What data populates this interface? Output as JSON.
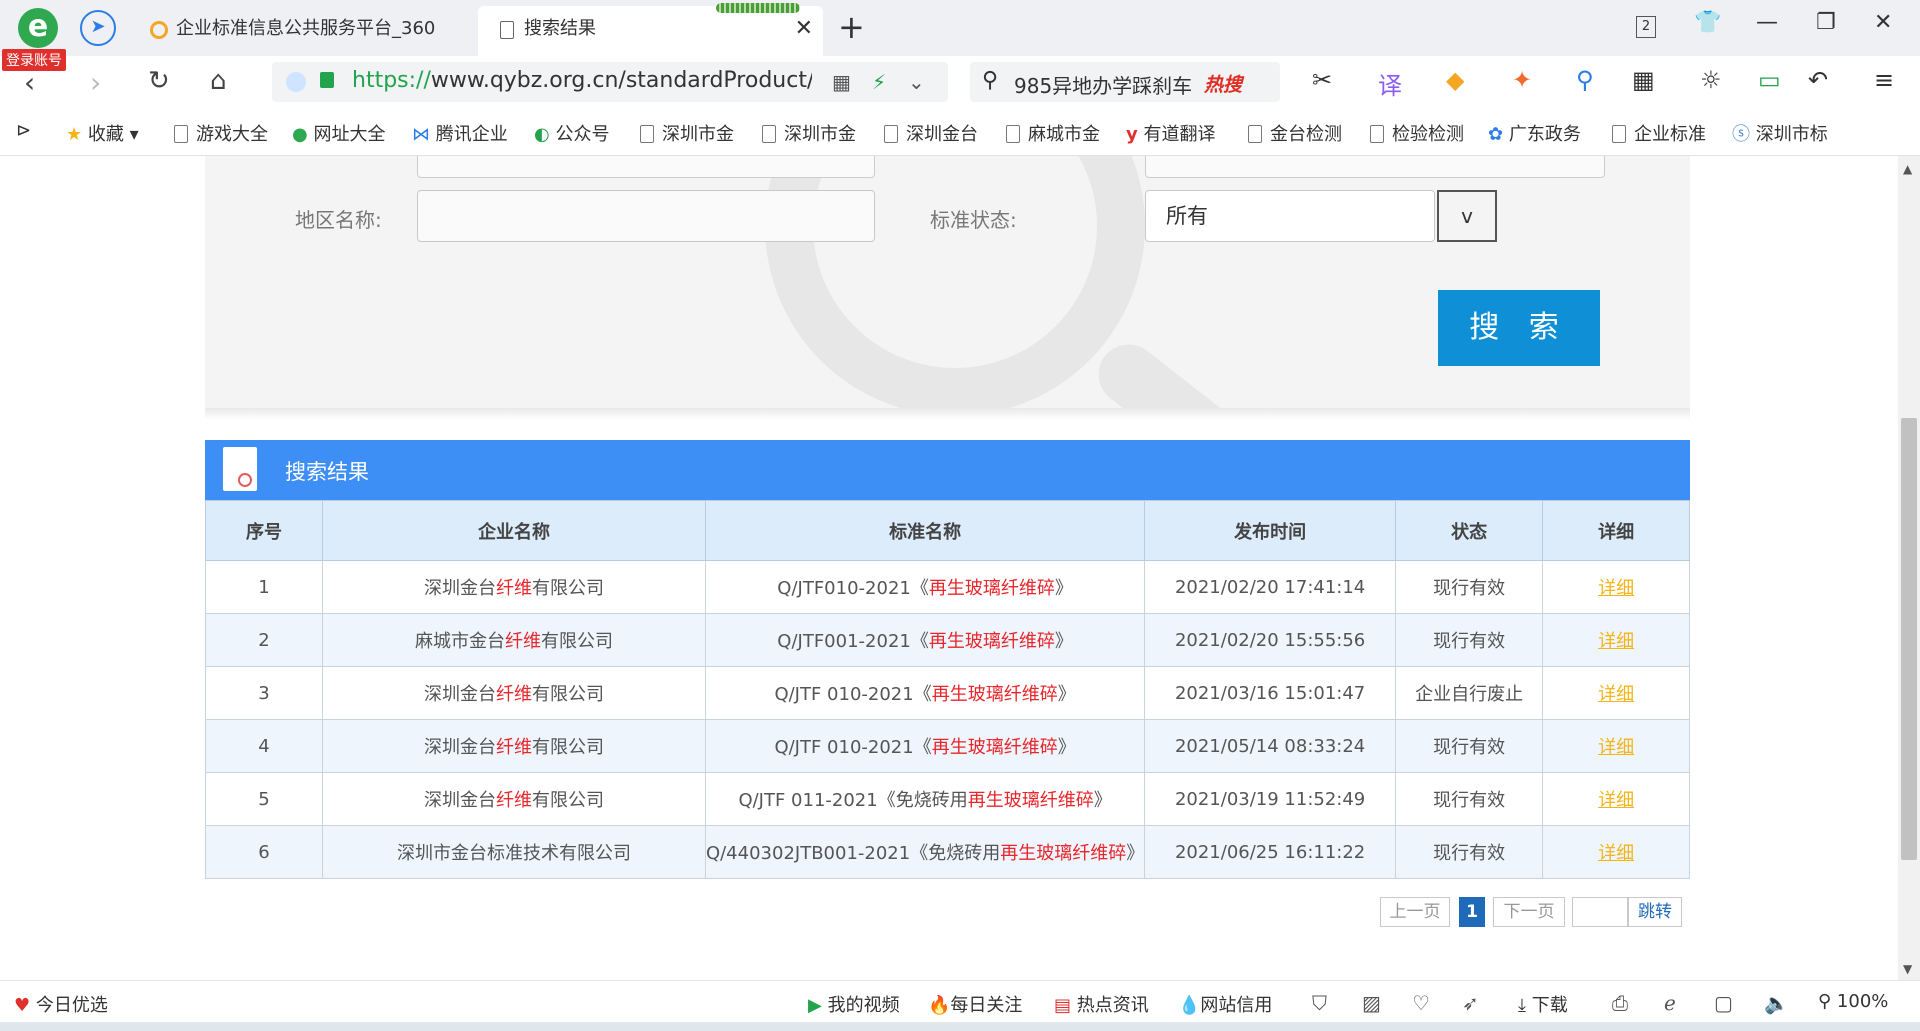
{
  "browser": {
    "login_badge": "登录账号",
    "tabs": [
      {
        "title": "企业标准信息公共服务平台_360",
        "active": false
      },
      {
        "title": "搜索结果",
        "active": true
      }
    ],
    "tab_count": "2",
    "url_scheme": "https://",
    "url_rest": "www.qybz.org.cn/standardProduct/to/",
    "hot_search_text": "985异地办学踩刹车",
    "hot_search_badge": "热搜",
    "bookmarks": [
      "收藏",
      "游戏大全",
      "网址大全",
      "腾讯企业",
      "公众号",
      "深圳市金",
      "深圳市金",
      "深圳金台",
      "麻城市金",
      "有道翻译",
      "金台检测",
      "检验检测",
      "广东政务",
      "企业标准",
      "深圳市标"
    ]
  },
  "search_form": {
    "region_label": "地区名称:",
    "region_value": "",
    "status_label": "标准状态:",
    "status_value": "所有",
    "status_dropdown_btn": "v",
    "search_button": "搜 索"
  },
  "results": {
    "header_title": "搜索结果",
    "columns": [
      "序号",
      "企业名称",
      "标准名称",
      "发布时间",
      "状态",
      "详细"
    ],
    "rows": [
      {
        "no": "1",
        "company_pre": "深圳金台",
        "company_hl": "纤维",
        "company_post": "有限公司",
        "std_pre": "Q/JTF010-2021《",
        "std_hl": "再生玻璃纤维碎",
        "std_post": "》",
        "time": "2021/02/20 17:41:14",
        "status": "现行有效",
        "detail": "详细"
      },
      {
        "no": "2",
        "company_pre": "麻城市金台",
        "company_hl": "纤维",
        "company_post": "有限公司",
        "std_pre": "Q/JTF001-2021《",
        "std_hl": "再生玻璃纤维碎",
        "std_post": "》",
        "time": "2021/02/20 15:55:56",
        "status": "现行有效",
        "detail": "详细"
      },
      {
        "no": "3",
        "company_pre": "深圳金台",
        "company_hl": "纤维",
        "company_post": "有限公司",
        "std_pre": "Q/JTF 010-2021《",
        "std_hl": "再生玻璃纤维碎",
        "std_post": "》",
        "time": "2021/03/16 15:01:47",
        "status": "企业自行废止",
        "detail": "详细"
      },
      {
        "no": "4",
        "company_pre": "深圳金台",
        "company_hl": "纤维",
        "company_post": "有限公司",
        "std_pre": "Q/JTF 010-2021《",
        "std_hl": "再生玻璃纤维碎",
        "std_post": "》",
        "time": "2021/05/14 08:33:24",
        "status": "现行有效",
        "detail": "详细"
      },
      {
        "no": "5",
        "company_pre": "深圳金台",
        "company_hl": "纤维",
        "company_post": "有限公司",
        "std_pre": "Q/JTF 011-2021《免烧砖用",
        "std_hl": "再生玻璃纤维碎",
        "std_post": "》",
        "time": "2021/03/19 11:52:49",
        "status": "现行有效",
        "detail": "详细"
      },
      {
        "no": "6",
        "company_pre": "深圳市金台标准技术有限公司",
        "company_hl": "",
        "company_post": "",
        "std_pre": "Q/440302JTB001-2021《免烧砖用",
        "std_hl": "再生玻璃纤维碎",
        "std_post": "》",
        "time": "2021/06/25 16:11:22",
        "status": "现行有效",
        "detail": "详细"
      }
    ]
  },
  "pager": {
    "prev": "上一页",
    "current": "1",
    "next": "下一页",
    "jump_value": "",
    "jump_button": "跳转"
  },
  "statusbar": {
    "left": "今日优选",
    "my_video": "我的视频",
    "daily_follow": "每日关注",
    "hot_news": "热点资讯",
    "site_credit": "网站信用",
    "download": "下载",
    "zoom": "100%"
  },
  "colors": {
    "accent": "#3d8ef5",
    "search_button": "#0e8fd6",
    "highlight": "#e8262b",
    "detail_link": "#f5b518"
  }
}
